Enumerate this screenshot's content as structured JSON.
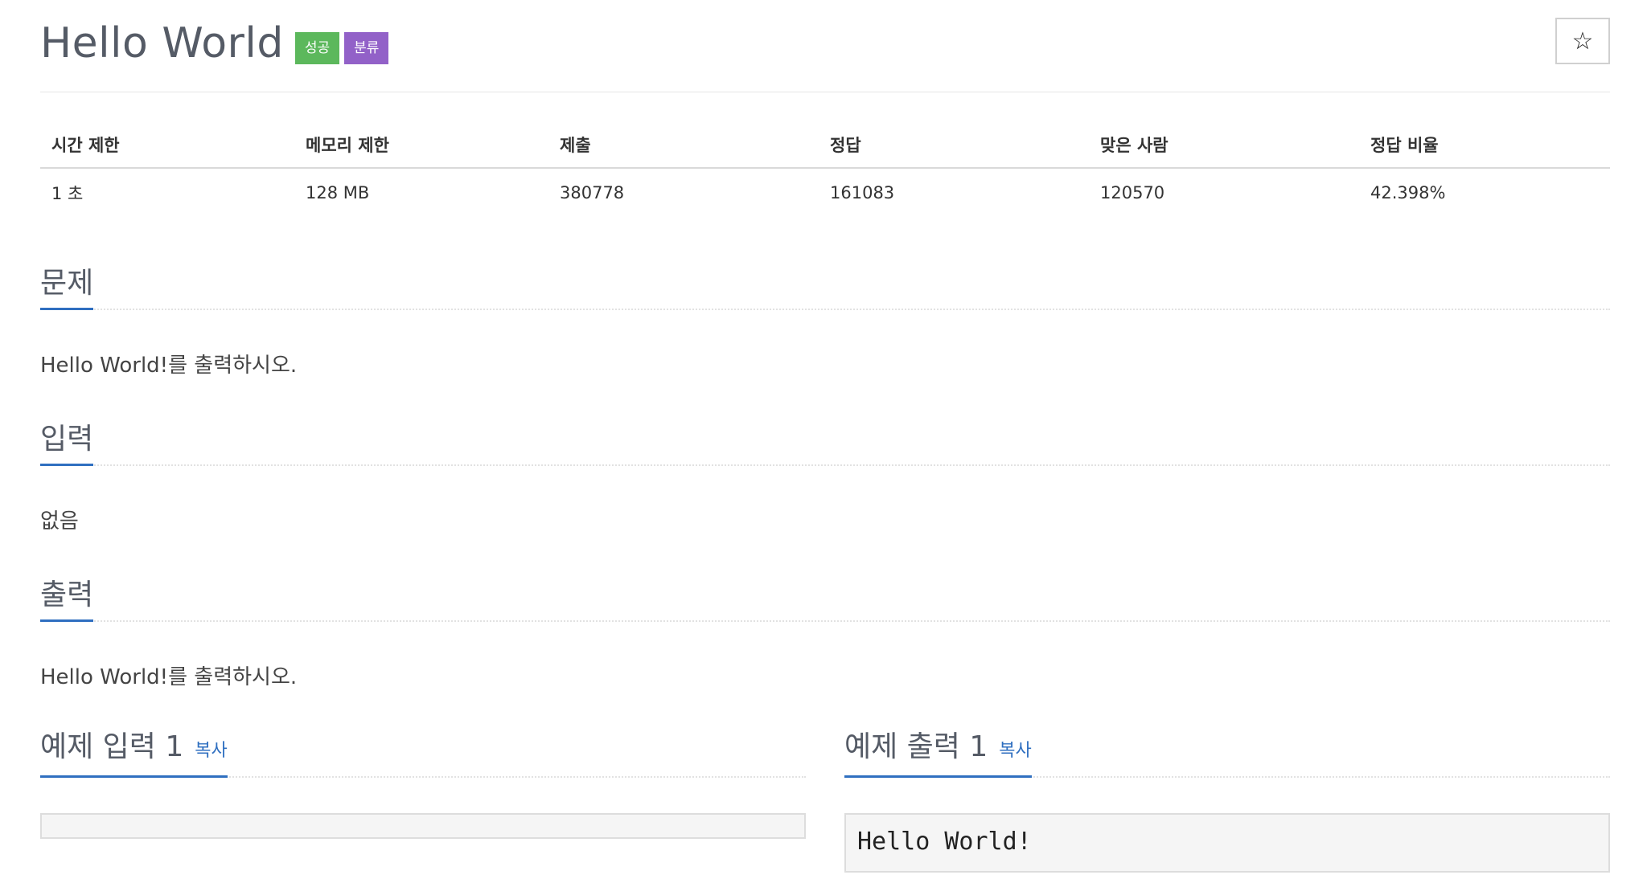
{
  "problem": {
    "title": "Hello World",
    "badges": {
      "success": "성공",
      "category": "분류"
    },
    "star_icon": "☆"
  },
  "info_table": {
    "headers": [
      "시간 제한",
      "메모리 제한",
      "제출",
      "정답",
      "맞은 사람",
      "정답 비율"
    ],
    "values": [
      "1 초",
      "128 MB",
      "380778",
      "161083",
      "120570",
      "42.398%"
    ]
  },
  "sections": {
    "description": {
      "title": "문제",
      "body": "Hello World!를 출력하시오."
    },
    "input": {
      "title": "입력",
      "body": "없음"
    },
    "output": {
      "title": "출력",
      "body": "Hello World!를 출력하시오."
    }
  },
  "samples": {
    "input_title": "예제 입력 1",
    "output_title": "예제 출력 1",
    "copy_label": "복사",
    "input_value": "",
    "output_value": "Hello World!"
  },
  "colors": {
    "success_badge": "#5cb85c",
    "category_badge": "#9261c8",
    "accent": "#2f6fc0"
  }
}
